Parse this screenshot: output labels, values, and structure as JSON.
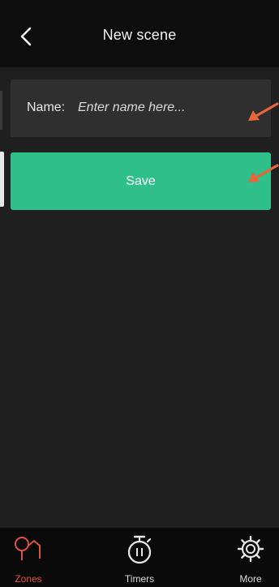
{
  "header": {
    "title": "New scene",
    "back_icon": "chevron-left-icon"
  },
  "form": {
    "name_label": "Name:",
    "name_placeholder": "Enter name here...",
    "name_value": "",
    "save_label": "Save"
  },
  "tabs": [
    {
      "label": "Zones",
      "icon": "zones-icon",
      "active": true
    },
    {
      "label": "Timers",
      "icon": "timer-icon",
      "active": false
    },
    {
      "label": "More",
      "icon": "gear-icon",
      "active": false
    }
  ],
  "colors": {
    "accent": "#2fbf8a",
    "active_tab": "#e0523f",
    "annotation_arrow": "#e8663a"
  }
}
